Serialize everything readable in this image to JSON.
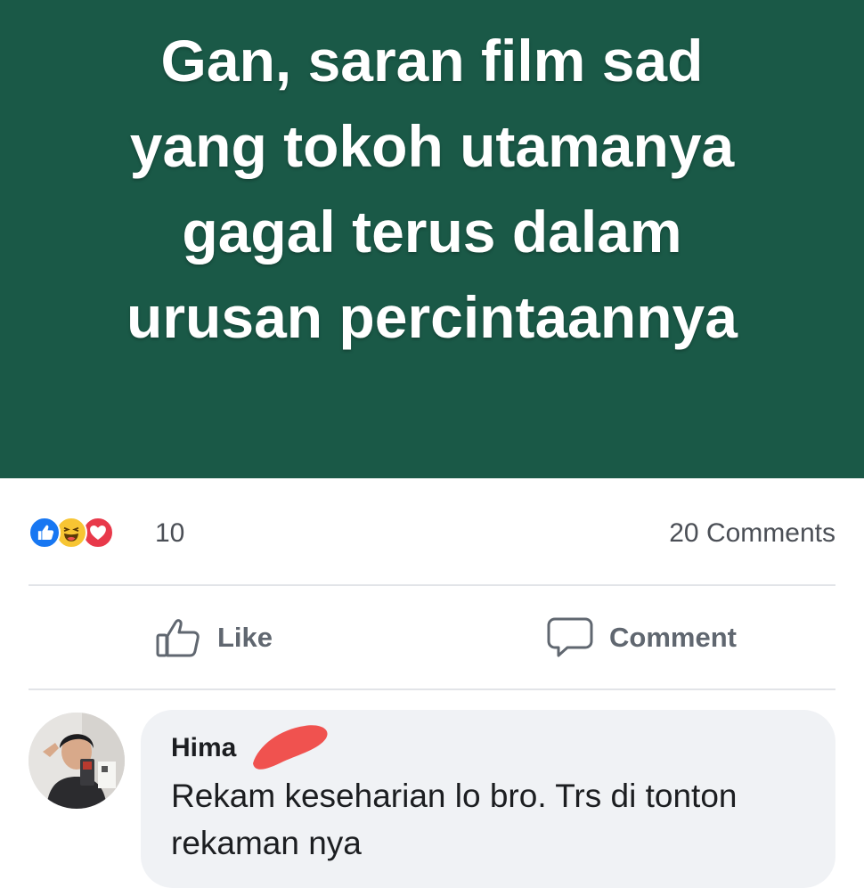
{
  "post": {
    "background_color": "#1a5947",
    "text_lines": [
      "Gan, saran film sad",
      "yang tokoh utamanya",
      "gagal terus dalam",
      "urusan percintaannya"
    ]
  },
  "reactions": {
    "icons": [
      "like-icon",
      "haha-icon",
      "love-icon"
    ],
    "count": "10",
    "comments_count_label": "20 Comments"
  },
  "actions": {
    "like_label": "Like",
    "comment_label": "Comment"
  },
  "comment": {
    "author_name": "Hima",
    "text": "Rekam keseharian lo bro. Trs di tonton rekaman nya"
  },
  "colors": {
    "banner": "#1a5947",
    "like_blue": "#1877f2",
    "haha_yellow": "#f7c533",
    "love_red": "#e8394a",
    "redaction_red": "#f0524f"
  }
}
